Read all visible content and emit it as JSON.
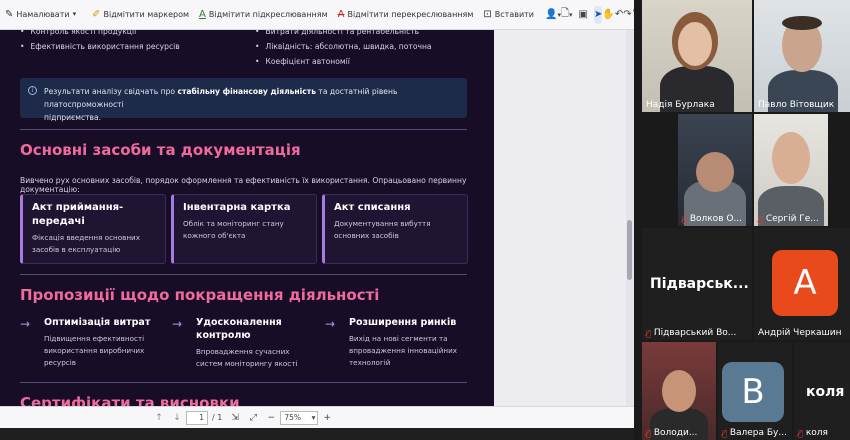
{
  "toolbar": {
    "draw_label": "Намалювати",
    "highlight_label": "Відмітити маркером",
    "underline_label": "Відмітити підкреслюванням",
    "strike_label": "Відмітити перекреслюванням",
    "insert_label": "Вставити"
  },
  "document": {
    "left_bullets": [
      "Контроль якості продукції",
      "Ефективність використання ресурсів"
    ],
    "right_bullets": [
      "Витрати діяльності та рентабельність",
      "Ліквідність: абсолютна, швидка, поточна",
      "Коефіцієнт автономії"
    ],
    "info_text_pre": "Результати аналізу свідчать про ",
    "info_text_bold": "стабільну фінансову діяльність",
    "info_text_post": " та достатній рівень платоспроможності",
    "info_text_line2": "підприємства.",
    "section1_title": "Основні засоби та документація",
    "section1_intro": "Вивчено рух основних засобів, порядок оформлення та ефективність їх використання. Опрацьовано первинну документацію:",
    "cards": [
      {
        "title": "Акт приймання-передачі",
        "desc": "Фіксація введення основних засобів в експлуатацію"
      },
      {
        "title": "Інвентарна картка",
        "desc": "Облік та моніторинг стану кожного об'єкта"
      },
      {
        "title": "Акт списання",
        "desc": "Документування вибуття основних засобів"
      }
    ],
    "section2_title": "Пропозиції щодо покращення діяльності",
    "proposals": [
      {
        "title": "Оптимізація витрат",
        "desc": "Підвищення ефективності використання виробничих ресурсів"
      },
      {
        "title": "Удосконалення контролю",
        "desc": "Впровадження сучасних систем моніторингу якості"
      },
      {
        "title": "Розширення ринків",
        "desc": "Вихід на нові сегменти та впровадження інноваційних технологій"
      }
    ],
    "section3_title": "Сертифікати та висновки"
  },
  "navbar": {
    "page_current": "1",
    "page_total": "/ 1",
    "zoom": "75%"
  },
  "tiles": {
    "t1_name": "Надія Бурлака",
    "t2_name": "Павло Вітовщик",
    "t3_name": "Волков О...",
    "t4_name": "Сергій Ге...",
    "t5_big": "Підварськ...",
    "t5_name": "Підварський Во...",
    "t6_letter": "А",
    "t6_name": "Андрій Черкашин",
    "t7_name": "Володи...",
    "t8_letter": "В",
    "t8_name": "Валера Бу...",
    "t9_big": "коля",
    "t9_name": "коля"
  },
  "colors": {
    "accent_pink": "#f06a9e",
    "accent_purple": "#a77be0",
    "active_speaker": "#3fbf7f",
    "avatar_orange": "#e84a1c",
    "avatar_blue": "#5a7a94"
  }
}
